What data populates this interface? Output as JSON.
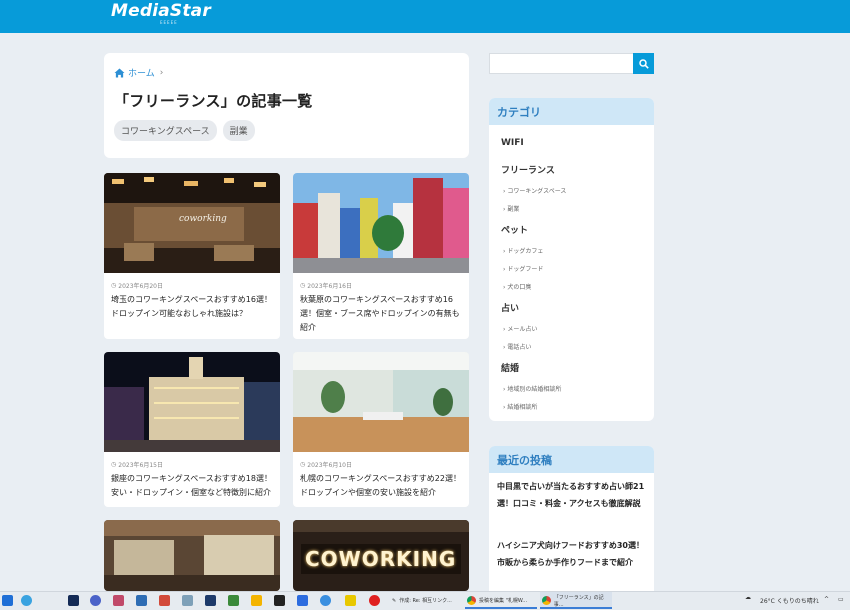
{
  "header": {
    "logo": "MediaStar",
    "logo_sub": "EEEEE"
  },
  "breadcrumb": {
    "home": "ホーム",
    "separator": "›"
  },
  "page": {
    "title": "「フリーランス」の記事一覧"
  },
  "tags": [
    "コワーキングスペース",
    "副業"
  ],
  "articles": [
    {
      "date": "2023年6月20日",
      "title": "埼玉のコワーキングスペースおすすめ16選！ドロップイン可能なおしゃれ施設は？"
    },
    {
      "date": "2023年6月16日",
      "title": "秋葉原のコワーキングスペースおすすめ16選！個室・ブース席やドロップインの有無も紹介"
    },
    {
      "date": "2023年6月15日",
      "title": "銀座のコワーキングスペースおすすめ18選！安い・ドロップイン・個室など特徴別に紹介"
    },
    {
      "date": "2023年6月10日",
      "title": "札幌のコワーキングスペースおすすめ22選！ドロップインや個室の安い施設を紹介"
    }
  ],
  "coworking_sign": "COWORKING",
  "sidebar": {
    "category_title": "カテゴリ",
    "categories": [
      {
        "label": "WIFI",
        "children": []
      },
      {
        "label": "フリーランス",
        "children": [
          "コワーキングスペース",
          "副業"
        ]
      },
      {
        "label": "ペット",
        "children": [
          "ドッグカフェ",
          "ドッグフード",
          "犬の口臭"
        ]
      },
      {
        "label": "占い",
        "children": [
          "メール占い",
          "電話占い"
        ]
      },
      {
        "label": "結婚",
        "children": [
          "地域別の結婚相談所",
          "結婚相談所"
        ]
      }
    ],
    "recent_title": "最近の投稿",
    "recent": [
      "中目黒で占いが当たるおすすめ占い師21選！口コミ・料金・アクセスも徹底解説",
      "ハイシニア犬向けフードおすすめ30選！市販から柔らか手作りフードまで紹介"
    ]
  },
  "taskbar": {
    "tasks": [
      "作成: Re: 相互リンク...",
      "投稿を編集 \"札幌W...",
      "「フリーランス」の記事..."
    ],
    "weather": "26°C くもりのち晴れ"
  },
  "colors": {
    "brand": "#079bd9",
    "widget_head_bg": "#cfe7f7",
    "widget_head_text": "#2f7fc0"
  }
}
